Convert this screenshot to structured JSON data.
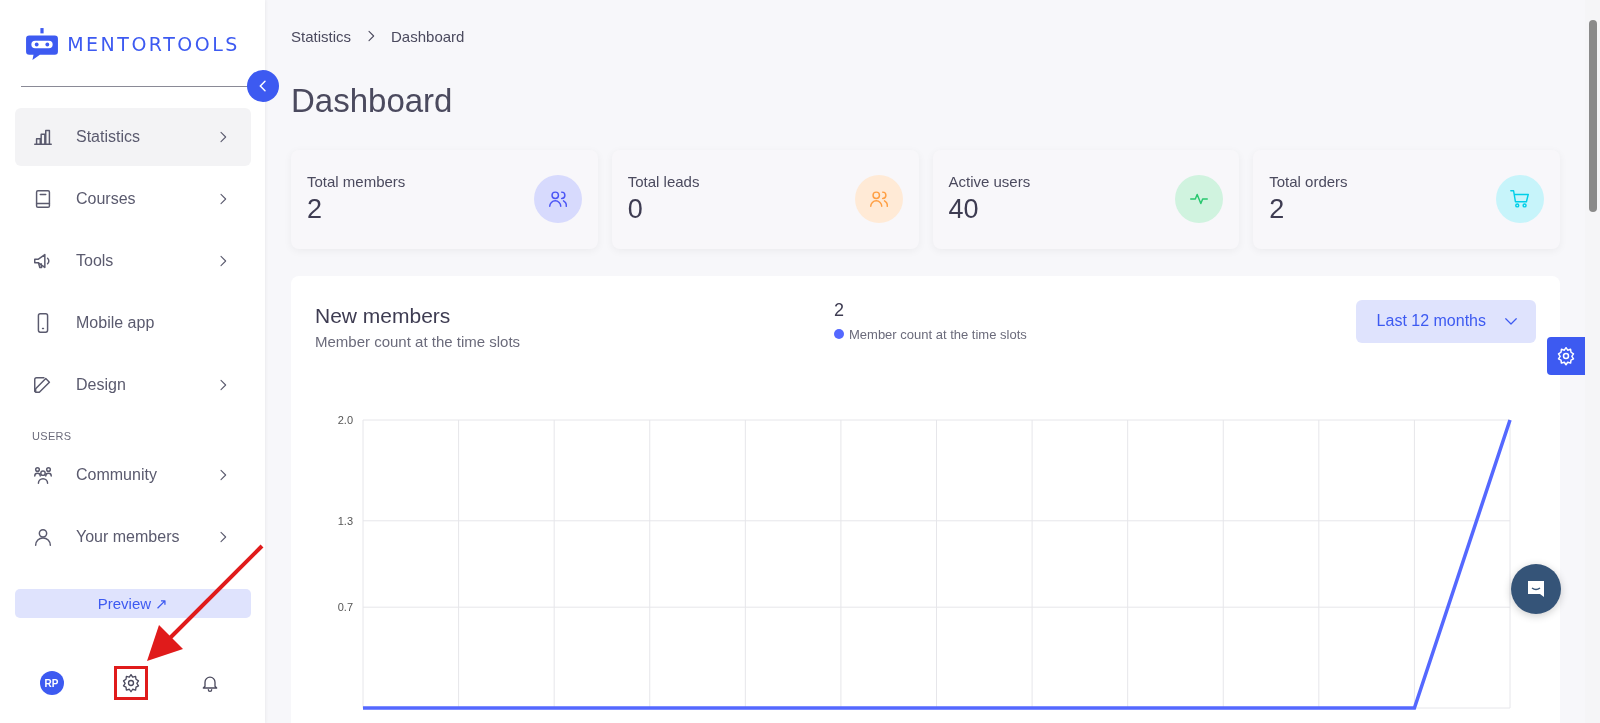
{
  "logo": {
    "text": "MENTORTOOLS"
  },
  "sidebar": {
    "items": [
      {
        "kind": "item",
        "label": "Statistics",
        "selected": true,
        "has_submenu": true
      },
      {
        "kind": "item",
        "label": "Courses",
        "selected": false,
        "has_submenu": true
      },
      {
        "kind": "item",
        "label": "Tools",
        "selected": false,
        "has_submenu": true
      },
      {
        "kind": "item",
        "label": "Mobile app",
        "selected": false,
        "has_submenu": false
      },
      {
        "kind": "item",
        "label": "Design",
        "selected": false,
        "has_submenu": true
      },
      {
        "kind": "section",
        "label": "USERS"
      },
      {
        "kind": "item",
        "label": "Community",
        "selected": false,
        "has_submenu": true
      },
      {
        "kind": "item",
        "label": "Your members",
        "selected": false,
        "has_submenu": true
      }
    ],
    "preview_button": {
      "label": "Preview ↗"
    },
    "bottom_icons": [
      {
        "kind": "avatar",
        "text": "RP",
        "highlighted": false
      },
      {
        "kind": "settings",
        "highlighted": true
      },
      {
        "kind": "bell",
        "highlighted": false
      }
    ]
  },
  "breadcrumb": [
    "Statistics",
    "Dashboard"
  ],
  "page_title": "Dashboard",
  "stat_cards": [
    {
      "label": "Total members",
      "value": "2",
      "color": "#4b55f5"
    },
    {
      "label": "Total leads",
      "value": "0",
      "color": "#ff9f43"
    },
    {
      "label": "Active users",
      "value": "40",
      "color": "#28c76f"
    },
    {
      "label": "Total orders",
      "value": "2",
      "color": "#00cfe8"
    }
  ],
  "new_members": {
    "title": "New members",
    "subtitle": "Member count at the time slots",
    "total": "2",
    "period": {
      "value": "Last 12 months"
    },
    "chart_data": {
      "type": "line",
      "grid": true,
      "ylim": [
        0,
        2
      ],
      "yticks": [
        {
          "value": 0.7,
          "label": "0.7"
        },
        {
          "value": 1.3,
          "label": "1.3"
        },
        {
          "value": 2,
          "label": "2.0"
        }
      ],
      "series": [
        {
          "name": "Member count at the time slots",
          "color": "#5468ff",
          "values": [
            0,
            0,
            0,
            0,
            0,
            0,
            0,
            0,
            0,
            0,
            0,
            0,
            2
          ]
        }
      ]
    }
  }
}
